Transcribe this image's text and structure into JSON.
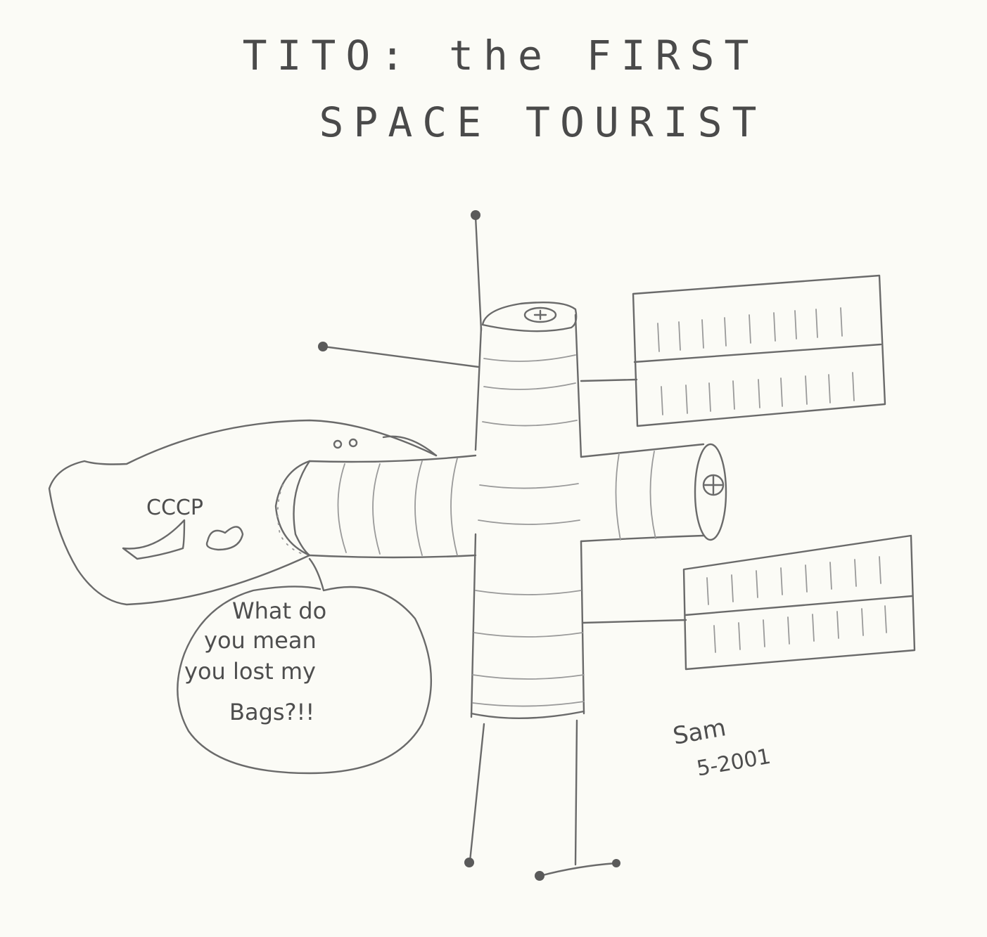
{
  "title": {
    "line1": "TITO: the FIRST",
    "line2": "SPACE TOURIST"
  },
  "spacecraft_label": "CCCP",
  "speech_bubble": {
    "line1": "What do",
    "line2": "you mean",
    "line3": "you lost my",
    "line4": "Bags?!!"
  },
  "signature": {
    "name": "Sam",
    "date": "5-2001"
  },
  "colors": {
    "paper": "#fbfbf6",
    "pencil": "#6a6a6a"
  }
}
